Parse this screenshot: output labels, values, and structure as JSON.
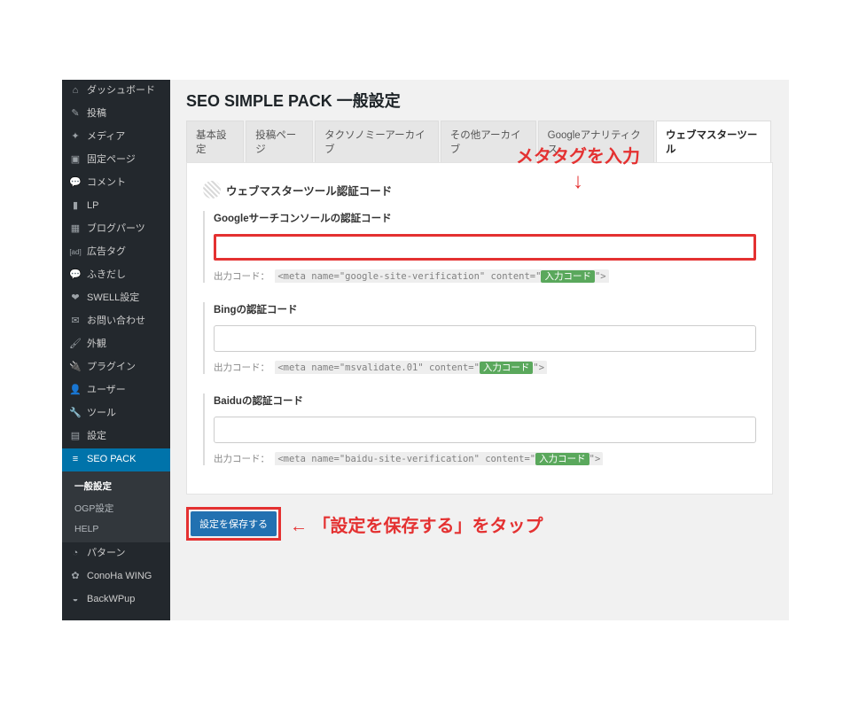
{
  "page": {
    "title": "SEO SIMPLE PACK 一般設定"
  },
  "sidebar": {
    "items": [
      {
        "icon": "⌂",
        "label": "ダッシュボード"
      },
      {
        "icon": "✎",
        "label": "投稿"
      },
      {
        "icon": "✦",
        "label": "メディア"
      },
      {
        "icon": "▣",
        "label": "固定ページ"
      },
      {
        "icon": "💬",
        "label": "コメント"
      },
      {
        "icon": "▮",
        "label": "LP"
      },
      {
        "icon": "▦",
        "label": "ブログパーツ"
      },
      {
        "icon": "[ad]",
        "label": "広告タグ"
      },
      {
        "icon": "💬",
        "label": "ふきだし"
      },
      {
        "icon": "❤",
        "label": "SWELL設定"
      },
      {
        "icon": "✉",
        "label": "お問い合わせ"
      },
      {
        "icon": "🖌",
        "label": "外観"
      },
      {
        "icon": "🔌",
        "label": "プラグイン"
      },
      {
        "icon": "👤",
        "label": "ユーザー"
      },
      {
        "icon": "🔧",
        "label": "ツール"
      },
      {
        "icon": "▤",
        "label": "設定"
      },
      {
        "icon": "≡",
        "label": "SEO PACK"
      }
    ],
    "sub": [
      {
        "label": "一般設定",
        "current": true
      },
      {
        "label": "OGP設定"
      },
      {
        "label": "HELP"
      }
    ],
    "tail": [
      {
        "icon": "◔",
        "label": "パターン"
      },
      {
        "icon": "✿",
        "label": "ConoHa WING"
      },
      {
        "icon": "◒",
        "label": "BackWPup"
      }
    ]
  },
  "tabs": [
    {
      "label": "基本設定"
    },
    {
      "label": "投稿ページ"
    },
    {
      "label": "タクソノミーアーカイブ"
    },
    {
      "label": "その他アーカイブ"
    },
    {
      "label": "Googleアナリティクス"
    },
    {
      "label": "ウェブマスターツール",
      "active": true
    }
  ],
  "section": {
    "title": "ウェブマスターツール認証コード"
  },
  "fields": {
    "google": {
      "label": "Googleサーチコンソールの認証コード",
      "value": "",
      "output_prefix": "出力コード：",
      "code_pre": "<meta name=\"google-site-verification\" content=\"",
      "code_chip": "入力コード",
      "code_post": "\">"
    },
    "bing": {
      "label": "Bingの認証コード",
      "value": "",
      "output_prefix": "出力コード：",
      "code_pre": "<meta name=\"msvalidate.01\" content=\"",
      "code_chip": "入力コード",
      "code_post": "\">"
    },
    "baidu": {
      "label": "Baiduの認証コード",
      "value": "",
      "output_prefix": "出力コード：",
      "code_pre": "<meta name=\"baidu-site-verification\" content=\"",
      "code_chip": "入力コード",
      "code_post": "\">"
    }
  },
  "save": {
    "label": "設定を保存する"
  },
  "annotations": {
    "top": "メタタグを入力",
    "arrow_down": "↓",
    "bottom_arrow": "←",
    "bottom": "「設定を保存する」をタップ"
  }
}
